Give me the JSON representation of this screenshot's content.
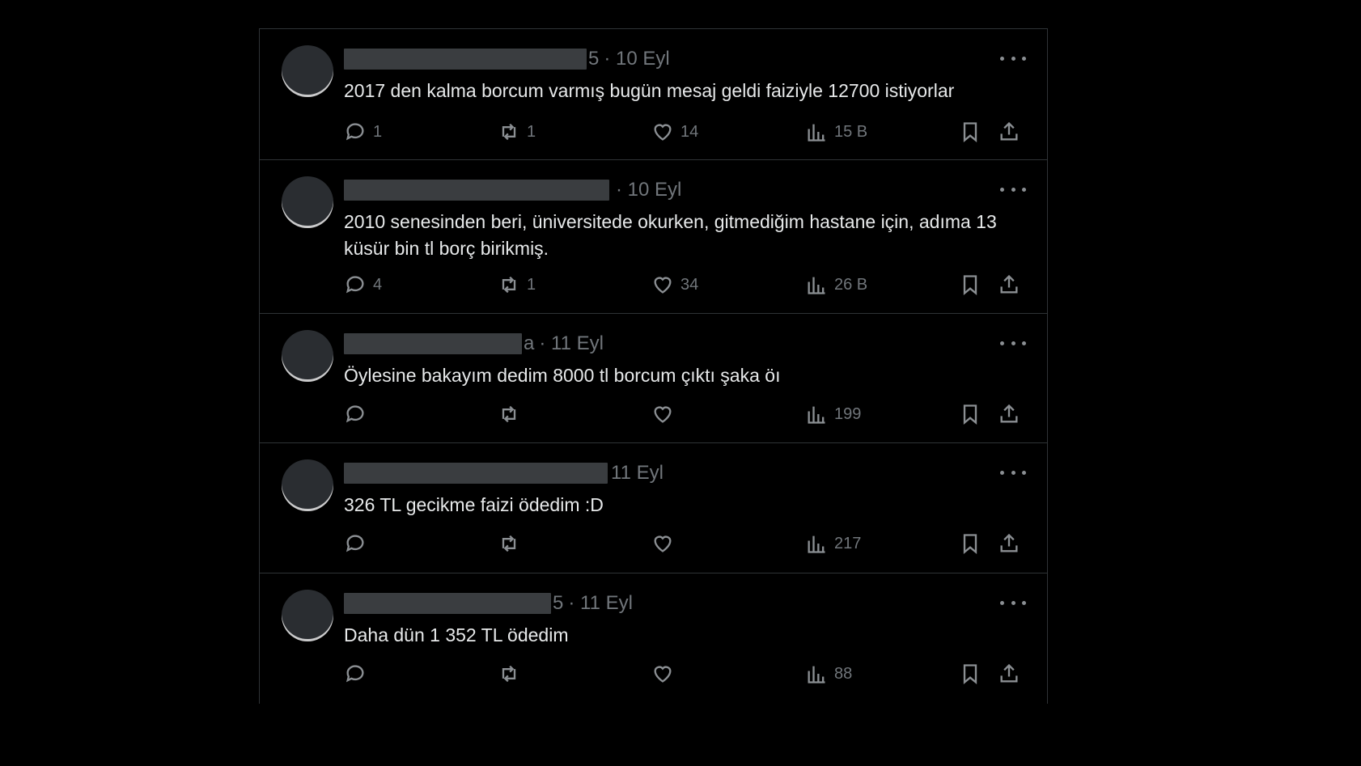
{
  "tweets": [
    {
      "date": "· 10 Eyl",
      "redact_tail": "5",
      "text": "2017 den kalma borcum varmış bugün mesaj geldi faiziyle 12700 istiyorlar",
      "replies": "1",
      "retweets": "1",
      "likes": "14",
      "views": "15 B"
    },
    {
      "date": "· 10 Eyl",
      "redact_tail": "",
      "text": "2010 senesinden beri, üniversitede okurken, gitmediğim hastane için, adıma 13 küsür bin tl borç birikmiş.",
      "replies": "4",
      "retweets": "1",
      "likes": "34",
      "views": "26 B"
    },
    {
      "date": "· 11 Eyl",
      "redact_tail": "a",
      "text": "Öylesine bakayım dedim 8000 tl borcum çıktı şaka öı",
      "replies": "",
      "retweets": "",
      "likes": "",
      "views": "199"
    },
    {
      "date": "11 Eyl",
      "redact_tail": "",
      "text": "326 TL gecikme faizi ödedim :D",
      "replies": "",
      "retweets": "",
      "likes": "",
      "views": "217"
    },
    {
      "date": "· 11 Eyl",
      "redact_tail": "5",
      "text": "Daha dün 1 352 TL ödedim",
      "replies": "",
      "retweets": "",
      "likes": "",
      "views": "88"
    }
  ],
  "icons": {
    "reply": "reply-icon",
    "retweet": "retweet-icon",
    "like": "heart-icon",
    "views": "views-icon",
    "bookmark": "bookmark-icon",
    "share": "share-icon",
    "more": "more-icon"
  },
  "colors": {
    "background": "#000000",
    "text": "#e7e9ea",
    "muted": "#71767b",
    "border": "#2f3336"
  }
}
